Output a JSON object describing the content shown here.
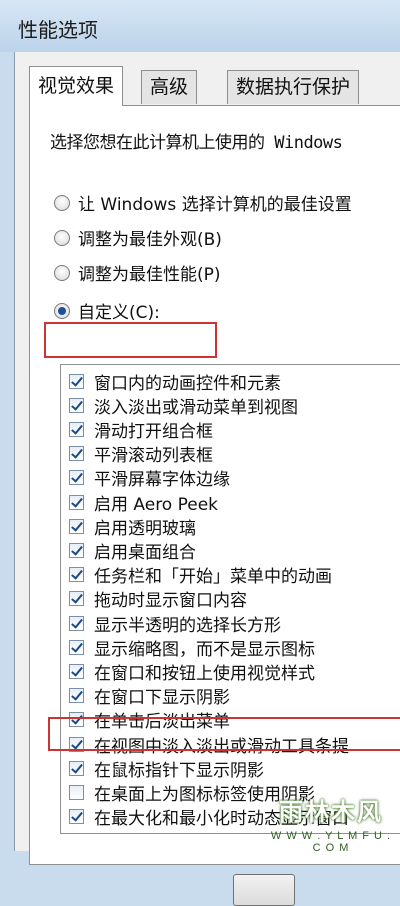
{
  "window": {
    "title": "性能选项"
  },
  "tabs": [
    {
      "label": "视觉效果",
      "active": true
    },
    {
      "label": "高级",
      "active": false
    },
    {
      "label": "数据执行保护",
      "active": false
    }
  ],
  "prompt": "选择您想在此计算机上使用的 Windows",
  "radios": [
    {
      "label": "让 Windows 选择计算机的最佳设置",
      "selected": false
    },
    {
      "label": "调整为最佳外观(B)",
      "selected": false
    },
    {
      "label": "调整为最佳性能(P)",
      "selected": false
    },
    {
      "label": "自定义(C):",
      "selected": true
    }
  ],
  "effects": [
    {
      "label": "窗口内的动画控件和元素",
      "checked": true
    },
    {
      "label": "淡入淡出或滑动菜单到视图",
      "checked": true
    },
    {
      "label": "滑动打开组合框",
      "checked": true
    },
    {
      "label": "平滑滚动列表框",
      "checked": true
    },
    {
      "label": "平滑屏幕字体边缘",
      "checked": true
    },
    {
      "label": "启用 Aero Peek",
      "checked": true
    },
    {
      "label": "启用透明玻璃",
      "checked": true
    },
    {
      "label": "启用桌面组合",
      "checked": true
    },
    {
      "label": "任务栏和「开始」菜单中的动画",
      "checked": true
    },
    {
      "label": "拖动时显示窗口内容",
      "checked": true
    },
    {
      "label": "显示半透明的选择长方形",
      "checked": true
    },
    {
      "label": "显示缩略图，而不是显示图标",
      "checked": true
    },
    {
      "label": "在窗口和按钮上使用视觉样式",
      "checked": true
    },
    {
      "label": "在窗口下显示阴影",
      "checked": true
    },
    {
      "label": "在单击后淡出菜单",
      "checked": true
    },
    {
      "label": "在视图中淡入淡出或滑动工具条提",
      "checked": true
    },
    {
      "label": "在鼠标指针下显示阴影",
      "checked": true
    },
    {
      "label": "在桌面上为图标标签使用阴影",
      "checked": false
    },
    {
      "label": "在最大化和最小化时动态显示窗口",
      "checked": true
    }
  ],
  "watermark": {
    "text": "雨林木风",
    "url": "W W W . Y L M F U . C O M"
  }
}
